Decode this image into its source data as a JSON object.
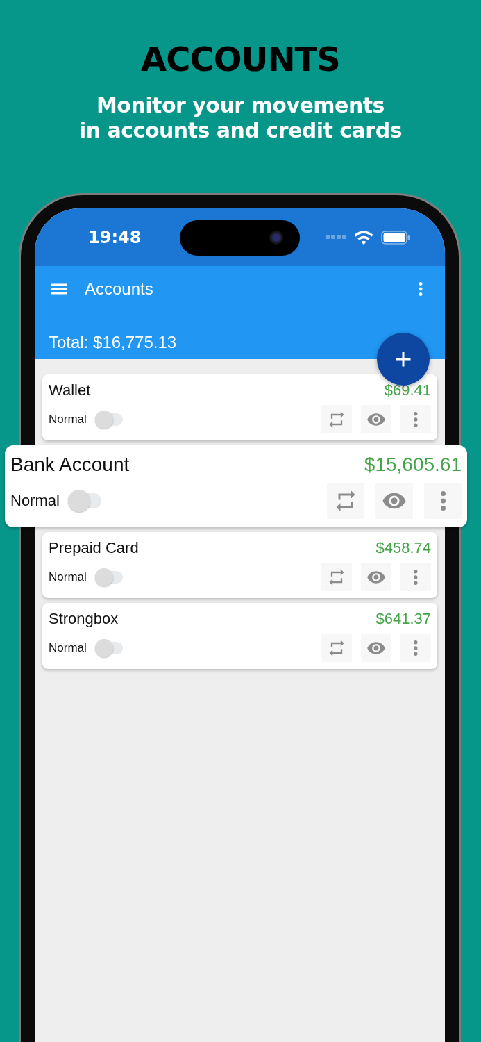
{
  "promo": {
    "title": "ACCOUNTS",
    "subtitle_lines": [
      "Monitor your movements",
      "in accounts and credit cards"
    ]
  },
  "status_bar": {
    "time": "19:48"
  },
  "app_bar": {
    "title": "Accounts",
    "total": "Total: $16,775.13"
  },
  "accounts": [
    {
      "name": "Wallet",
      "balance": "$69.41",
      "mode": "Normal",
      "on": false,
      "kind": "regular"
    },
    {
      "name": "Bank Account",
      "balance": "$15,605.61",
      "mode": "Normal",
      "on": false,
      "kind": "featured"
    },
    {
      "name": "Prepaid Card",
      "balance": "$458.74",
      "mode": "Normal",
      "on": false,
      "kind": "regular"
    },
    {
      "name": "Strongbox",
      "balance": "$641.37",
      "mode": "Normal",
      "on": false,
      "kind": "regular"
    }
  ]
}
